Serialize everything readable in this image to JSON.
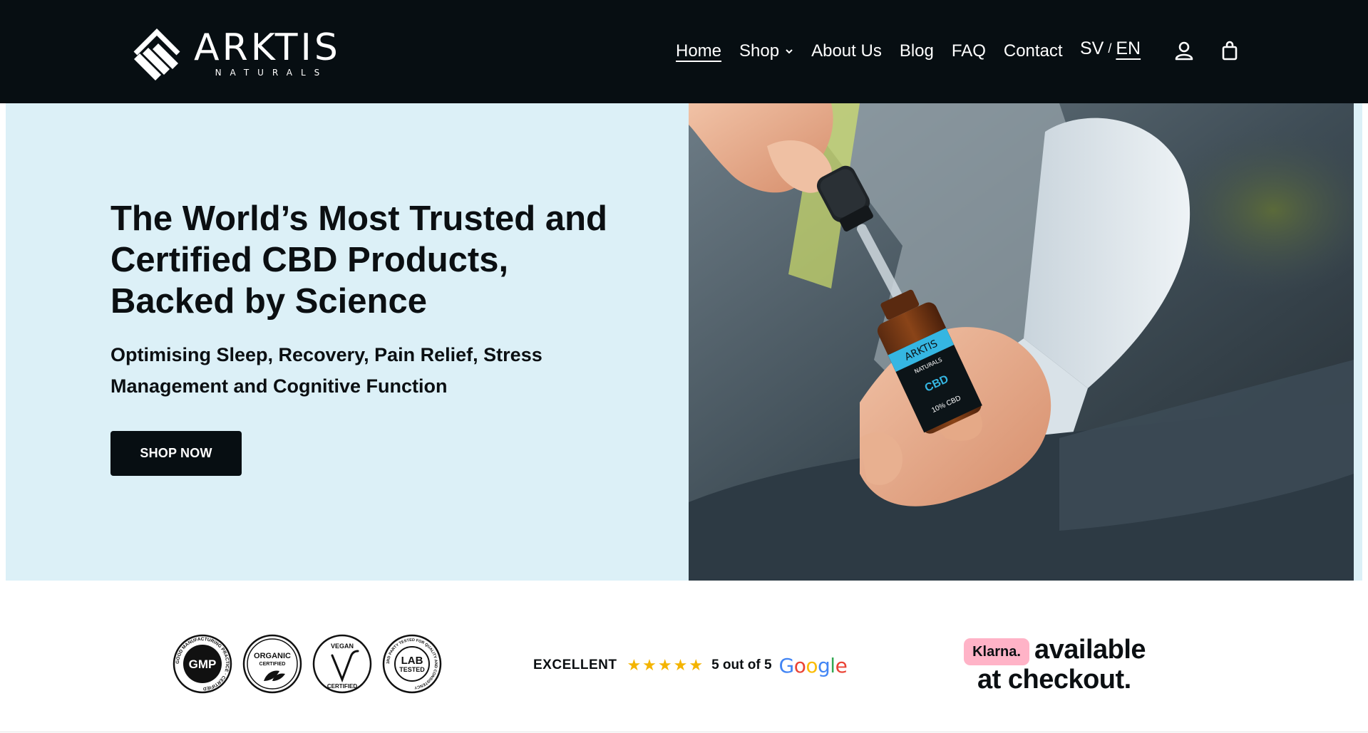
{
  "header": {
    "brand": {
      "name": "ARKTIS",
      "subtitle": "NATURALS"
    },
    "nav": [
      {
        "label": "Home",
        "active": true
      },
      {
        "label": "Shop",
        "has_dropdown": true
      },
      {
        "label": "About Us"
      },
      {
        "label": "Blog"
      },
      {
        "label": "FAQ"
      },
      {
        "label": "Contact"
      }
    ],
    "language": {
      "options": [
        "SV",
        "EN"
      ],
      "separator": "/",
      "selected": "EN"
    },
    "icons": [
      "account-icon",
      "shopping-bag-icon"
    ]
  },
  "hero": {
    "title": "The World’s Most Trusted and Certified CBD Products, Backed by Science",
    "subtitle": "Optimising Sleep, Recovery, Pain Relief, Stress Management and Cognitive Function",
    "cta_label": "SHOP NOW",
    "image": {
      "bottle_brand": "ARKTIS",
      "bottle_brand_sub": "NATURALS",
      "bottle_label": "CBD",
      "bottle_strength": "10% CBD"
    }
  },
  "trust": {
    "badges": [
      {
        "name": "gmp-badge",
        "center_text": "GMP",
        "ring_text": "GOOD MANUFACTURING PRACTICE · CERTIFIED"
      },
      {
        "name": "organic-badge",
        "line1": "ORGANIC",
        "line2": "CERTIFIED"
      },
      {
        "name": "vegan-badge",
        "top": "VEGAN",
        "bottom": "CERTIFIED"
      },
      {
        "name": "lab-tested-badge",
        "line1": "LAB",
        "line2": "TESTED",
        "ring_text": "3RD PARTY TESTED FOR QUALITY AND CONSISTENCY"
      }
    ],
    "rating": {
      "label": "EXCELLENT",
      "stars": 5,
      "score_text": "5 out of 5",
      "provider": "Google"
    },
    "klarna": {
      "badge": "Klarna.",
      "line1": "available",
      "line2": "at checkout."
    }
  },
  "colors": {
    "header_bg": "#070e12",
    "hero_bg": "#dcf0f7",
    "cta_bg": "#070e12",
    "star": "#f4b400",
    "klarna_pink": "#ffb3c7",
    "bottle_accent": "#35b6e2"
  }
}
